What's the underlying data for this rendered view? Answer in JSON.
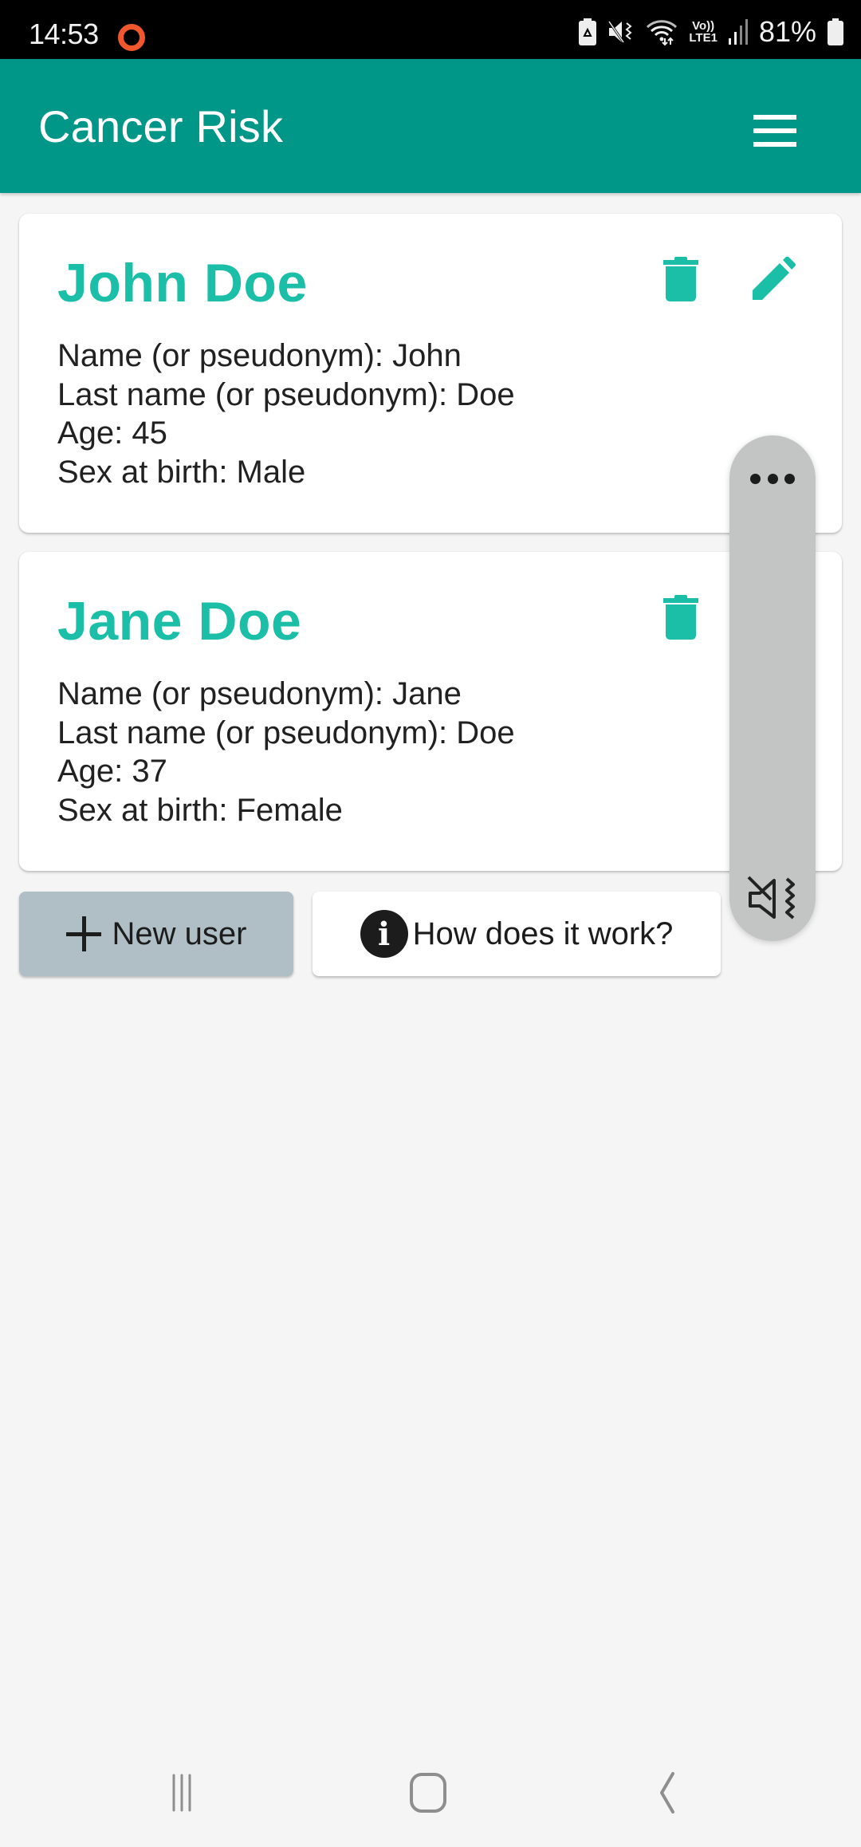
{
  "status_bar": {
    "time": "14:53",
    "battery_percent": "81%",
    "icons": [
      "recording-indicator-icon",
      "battery-saver-icon",
      "mute-vibrate-icon",
      "wifi-icon",
      "volte-lte-icon",
      "signal-icon",
      "battery-icon"
    ],
    "network_label_top": "Vo))",
    "network_label_bottom": "LTE1"
  },
  "app_bar": {
    "title": "Cancer Risk",
    "menu_icon": "hamburger-menu-icon"
  },
  "users": [
    {
      "display_name": "John Doe",
      "name_line": "Name (or pseudonym): John",
      "last_name_line": "Last name (or pseudonym): Doe",
      "age_line": "Age: 45",
      "sex_line": "Sex at birth: Male",
      "actions": [
        "trash-icon",
        "pencil-icon"
      ]
    },
    {
      "display_name": "Jane Doe",
      "name_line": "Name (or pseudonym): Jane",
      "last_name_line": "Last name (or pseudonym): Doe",
      "age_line": "Age: 37",
      "sex_line": "Sex at birth: Female",
      "actions": [
        "trash-icon"
      ]
    }
  ],
  "buttons": {
    "new_user": "New user",
    "how_it_works": "How does it work?",
    "info_glyph": "i"
  },
  "volume_panel": {
    "more_icon": "more-options-icon",
    "mode_icon": "vibrate-mute-icon"
  },
  "nav_bar": {
    "items": [
      "recents-icon",
      "home-icon",
      "back-icon"
    ]
  },
  "colors": {
    "primary": "#009688",
    "accent": "#1bbfa8",
    "new_user_button": "#b0bec5",
    "status_ring": "#f0572d"
  }
}
